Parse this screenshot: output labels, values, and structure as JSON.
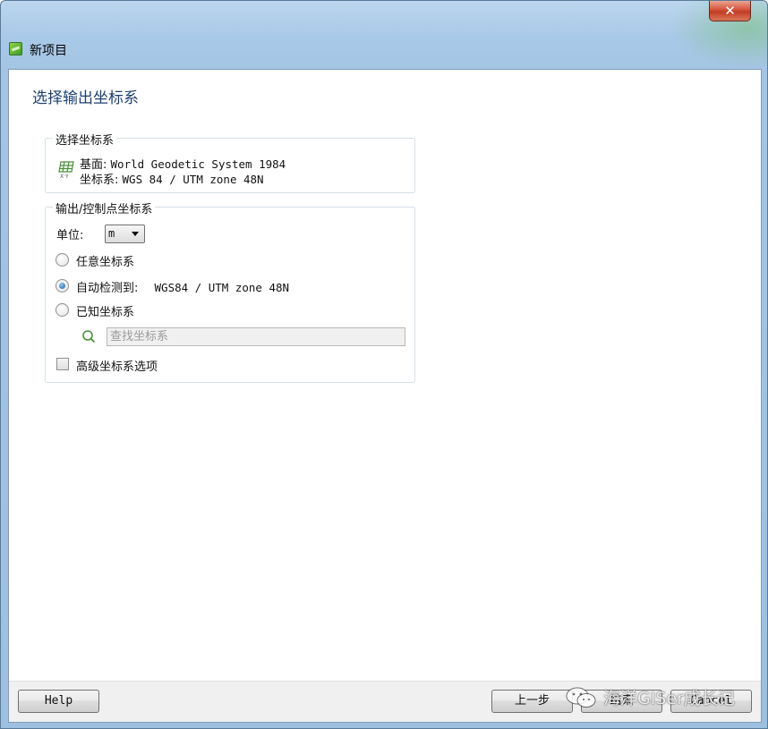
{
  "window": {
    "title": "新项目",
    "close_glyph": "✕"
  },
  "page": {
    "heading": "选择输出坐标系"
  },
  "selected_crs": {
    "legend": "选择坐标系",
    "icon": "crs-grid-icon",
    "datum_label": "基面:",
    "datum_value": "World Geodetic System 1984",
    "crs_label": "坐标系:",
    "crs_value": "WGS 84 / UTM zone 48N"
  },
  "output_crs": {
    "legend": "输出/控制点坐标系",
    "unit_label": "单位:",
    "unit_value": "m",
    "options": [
      {
        "label": "任意坐标系",
        "checked": false
      },
      {
        "label": "自动检测到:",
        "detail": "WGS84 / UTM zone 48N",
        "checked": true
      },
      {
        "label": "已知坐标系",
        "checked": false
      }
    ],
    "search_placeholder": "查找坐标系",
    "advanced_label": "高级坐标系选项",
    "advanced_checked": false
  },
  "footer": {
    "help_label": "Help",
    "back_label": "上一步",
    "next_label": "结束",
    "cancel_label": "Cancel"
  },
  "watermark": {
    "text": "海洋GISer成长记"
  }
}
